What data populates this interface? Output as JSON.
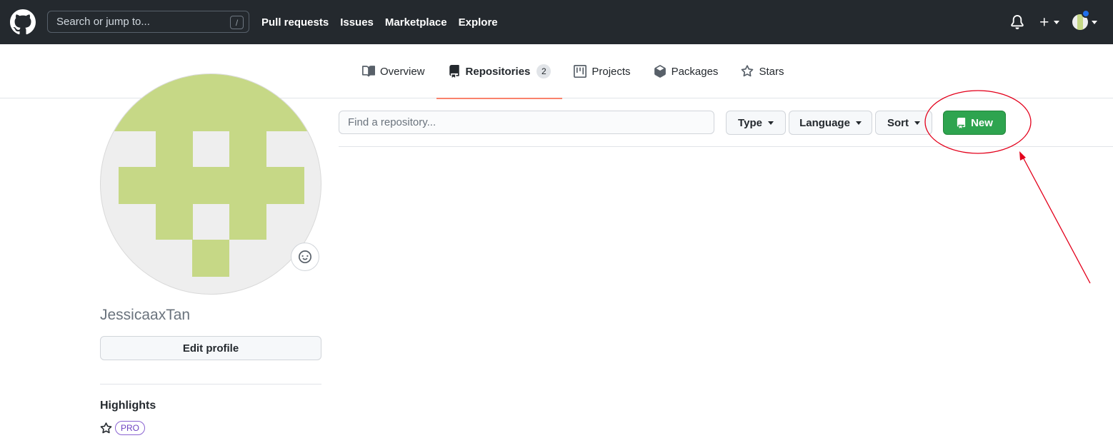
{
  "header": {
    "search": {
      "placeholder": "Search or jump to...",
      "shortcut": "/"
    },
    "nav": [
      {
        "label": "Pull requests"
      },
      {
        "label": "Issues"
      },
      {
        "label": "Marketplace"
      },
      {
        "label": "Explore"
      }
    ],
    "icons": [
      "github-logo-icon",
      "bell-icon",
      "plus-icon",
      "avatar"
    ]
  },
  "profile_nav": {
    "tabs": [
      {
        "label": "Overview",
        "icon": "book-icon"
      },
      {
        "label": "Repositories",
        "icon": "repo-icon",
        "count": "2",
        "active": true
      },
      {
        "label": "Projects",
        "icon": "project-icon"
      },
      {
        "label": "Packages",
        "icon": "package-icon"
      },
      {
        "label": "Stars",
        "icon": "star-icon"
      }
    ]
  },
  "sidebar": {
    "username": "JessicaaxTan",
    "edit_profile_label": "Edit profile",
    "highlights_title": "Highlights",
    "pro_badge": "PRO"
  },
  "repos": {
    "search_placeholder": "Find a repository...",
    "type_label": "Type",
    "language_label": "Language",
    "sort_label": "Sort",
    "new_label": "New"
  },
  "colors": {
    "header_bg": "#24292e",
    "new_button": "#2ea44f",
    "active_tab_underline": "#f9826c",
    "avatar_identicon": "#c6d886",
    "annotation": "#e3001b"
  }
}
